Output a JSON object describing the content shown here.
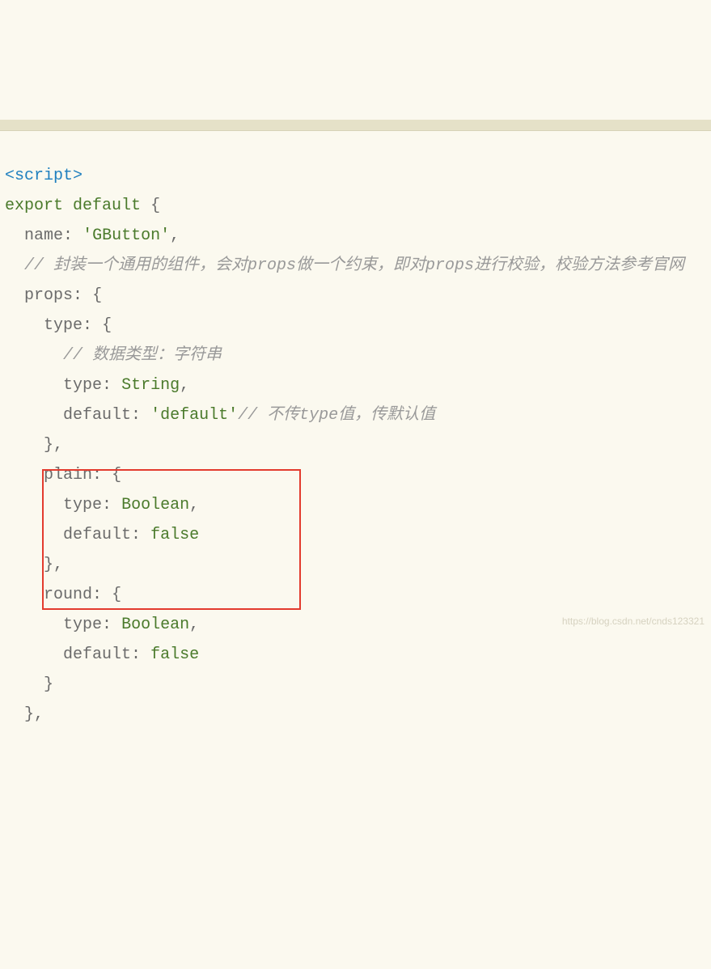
{
  "tag_open": "<script>",
  "l_export": "export",
  "l_default": "default",
  "l_name_key": "name",
  "l_name_val": "'GButton'",
  "comment_main": "// 封装一个通用的组件，会对props做一个约束，即对props进行校验，校验方法参考官网",
  "l_props": "props",
  "prop_type_key": "type",
  "comment_datatype": "// 数据类型：字符串",
  "inner_type_key": "type",
  "type_string": "String",
  "default_key": "default",
  "default_str": "'default'",
  "comment_default": "// 不传type值，传默认值",
  "plain_key": "plain",
  "type_boolean": "Boolean",
  "false_val": "false",
  "round_key": "round",
  "watermark": "https://blog.csdn.net/cnds123321"
}
